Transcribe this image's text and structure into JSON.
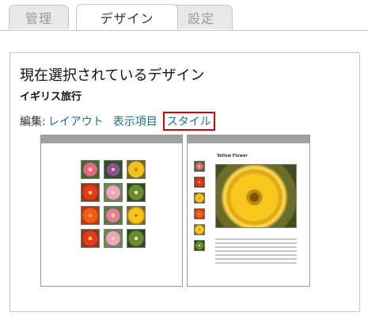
{
  "tabs": [
    {
      "label": "管理",
      "active": false
    },
    {
      "label": "デザイン",
      "active": true
    },
    {
      "label": "設定",
      "active": false
    }
  ],
  "panel": {
    "heading": "現在選択されているデザイン",
    "design_name": "イギリス旅行",
    "edit_label": "編集:",
    "edit_links": [
      {
        "label": "レイアウト",
        "selected": false
      },
      {
        "label": "表示項目",
        "selected": false
      },
      {
        "label": "スタイル",
        "selected": true
      }
    ]
  },
  "colors": {
    "link": "#1a6f96",
    "highlight_border": "#d8000c",
    "tab_inactive_bg": "#e8e8e8",
    "thumbnail_bar": "#a0a0a0"
  },
  "previews": [
    {
      "name": "grid-layout-preview",
      "flower_tiles": [
        "pink",
        "purple",
        "yellow",
        "red",
        "lpink",
        "green",
        "orange",
        "pink2",
        "yellow2",
        "red",
        "lpink",
        "green"
      ]
    },
    {
      "name": "detail-layout-preview",
      "photo_title": "Yellow Flower",
      "side_tiles": [
        "pink",
        "red",
        "yellow",
        "orange",
        "yellow2",
        "green"
      ]
    }
  ]
}
